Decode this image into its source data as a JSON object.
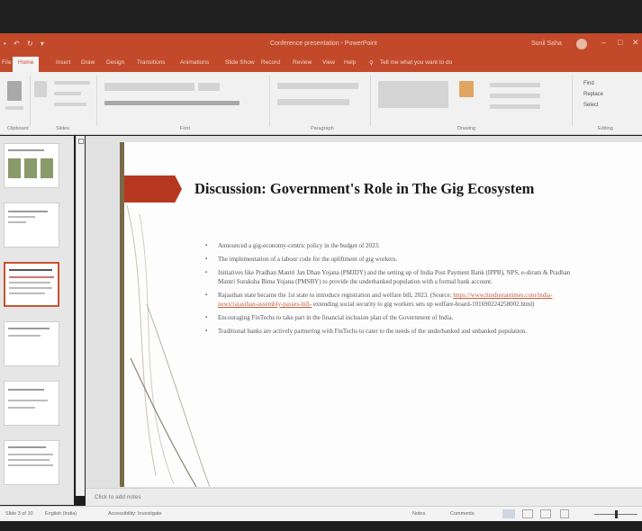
{
  "window": {
    "quick_access": "• ↶ ↻ ▾",
    "title": "Conference presentation - PowerPoint",
    "user": "Sunil Saha",
    "minimize": "–",
    "maximize": "□",
    "close": "✕"
  },
  "ribbon": {
    "tabs": [
      "File",
      "Home",
      "Insert",
      "Draw",
      "Design",
      "Transitions",
      "Animations",
      "Slide Show",
      "Record",
      "Review",
      "View",
      "Help"
    ],
    "tell_me": "Tell me what you want to do",
    "groups": {
      "clipboard": "Clipboard",
      "slides": "Slides",
      "font": "Font",
      "paragraph": "Paragraph",
      "drawing": "Drawing",
      "editing": "Editing"
    },
    "buttons": {
      "paste": "Paste",
      "new_slide": "New Slide",
      "layout": "Layout",
      "reset": "Reset",
      "section": "Section",
      "arrange": "Arrange",
      "quick_styles": "Quick Styles",
      "find": "Find",
      "replace": "Replace",
      "select": "Select"
    }
  },
  "slide": {
    "title": "Discussion: Government's Role in The Gig Ecosystem",
    "bullets": [
      {
        "text": "Announced a gig-economy-centric policy in the budget of 2023."
      },
      {
        "text": "The implementation of a labour code for the upliftment of gig workers."
      },
      {
        "text": "Initiatives like Pradhan Mantri Jan Dhan Yojana (PMJDY) and the setting up of India Post Payment Bank (IPPB), NPS, e-shram & Pradhan Mantri Suraksha Bima Yojana (PMSBY) to provide the underbanked population with a formal bank account."
      },
      {
        "text": "Rajasthan state became the 1st state to introduce registration and welfare bill, 2023. (Source: ",
        "link": "https://www.hindustantimes.com/india-news/rajasthan-assembly-passes-bill-",
        "text_after": " extending social security to gig workers sets up welfare-board-101690224258002.html)"
      },
      {
        "text": "Encouraging FinTechs to take part in the financial inclusion plan of the Government of India."
      },
      {
        "text": "Traditional banks are actively partnering with FinTechs to cater to the needs of the underbanked and unbanked population."
      }
    ]
  },
  "notes": {
    "placeholder": "Click to add notes"
  },
  "statusbar": {
    "slide_info": "Slide 3 of 10",
    "language": "English (India)",
    "accessibility": "Accessibility: Investigate",
    "notes_btn": "Notes",
    "comments_btn": "Comments"
  },
  "colors": {
    "ribbon_accent": "#c24a2a",
    "slide_accent": "#b6371f",
    "link": "#c2623c"
  }
}
